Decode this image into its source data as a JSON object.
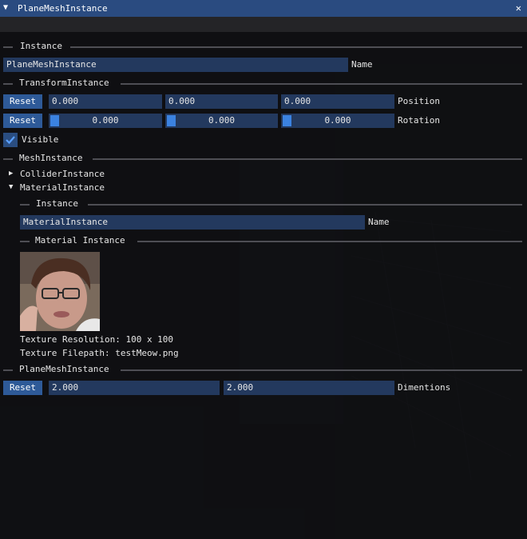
{
  "window": {
    "title": "PlaneMeshInstance",
    "title_bar_color": "#2a4b80"
  },
  "instance": {
    "header": "Instance",
    "name_value": "PlaneMeshInstance",
    "name_label": "Name"
  },
  "transform": {
    "header": "TransformInstance",
    "reset_label": "Reset",
    "position": {
      "values": [
        "0.000",
        "0.000",
        "0.000"
      ],
      "label": "Position"
    },
    "rotation": {
      "values": [
        "0.000",
        "0.000",
        "0.000"
      ],
      "label": "Rotation"
    }
  },
  "visible": {
    "label": "Visible",
    "checked": true
  },
  "mesh": {
    "header": "MeshInstance",
    "collider": {
      "label": "ColliderInstance",
      "expanded": false
    },
    "material": {
      "label": "MaterialInstance",
      "expanded": true,
      "instance_header": "Instance",
      "name_value": "MaterialInstance",
      "name_label": "Name",
      "material_header": "Material Instance",
      "texture_resolution": "Texture Resolution: 100 x 100",
      "texture_filepath": "Texture Filepath: testMeow.png"
    }
  },
  "plane": {
    "header": "PlaneMeshInstance",
    "reset_label": "Reset",
    "values": [
      "2.000",
      "2.000"
    ],
    "label": "Dimentions"
  },
  "colors": {
    "frame_bg": "#23395e",
    "button": "#2e5a98",
    "slider_grab": "#3b82e0",
    "separator": "#4e4e54"
  }
}
